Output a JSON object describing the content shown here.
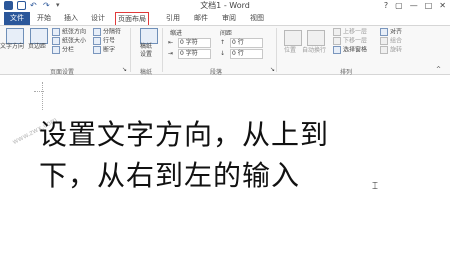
{
  "window": {
    "title": "文档1 - Word",
    "controls": [
      "?",
      "▢",
      "—",
      "□",
      "✕"
    ]
  },
  "tabs": [
    {
      "label": "文件"
    },
    {
      "label": "开始"
    },
    {
      "label": "插入"
    },
    {
      "label": "设计"
    },
    {
      "label": "页面布局"
    },
    {
      "label": "引用"
    },
    {
      "label": "邮件"
    },
    {
      "label": "审阅"
    },
    {
      "label": "视图"
    }
  ],
  "ribbon": {
    "text_direction": "文字方向",
    "margins": "页边距",
    "orientation": "纸张方向",
    "size": "纸张大小",
    "columns": "分栏",
    "breaks": "分隔符",
    "line_numbers": "行号",
    "hyphenation": "断字",
    "page_setup_group": "页面设置",
    "draft": "稿纸",
    "draft_settings": "设置",
    "draft_group": "稿纸",
    "indent_label": "缩进",
    "spacing_label": "间距",
    "indent_left_value": "0 字符",
    "indent_right_value": "0 字符",
    "spacing_before_value": "0 行",
    "spacing_after_value": "0 行",
    "paragraph_group": "段落",
    "position": "位置",
    "wrap_text": "自动换行",
    "bring_forward": "上移一层",
    "send_backward": "下移一层",
    "selection_pane": "选择窗格",
    "align": "对齐",
    "group": "组合",
    "rotate": "旋转",
    "arrange_group": "排列"
  },
  "document": {
    "line1": "设置文字方向，从上到",
    "line2": "下，从右到左的输入"
  },
  "watermark": "www.zwx.com"
}
